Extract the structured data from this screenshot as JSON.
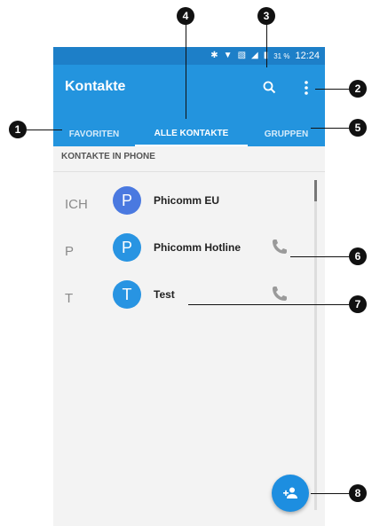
{
  "status_bar": {
    "battery_percent": "31 %",
    "time": "12:24"
  },
  "app_bar": {
    "title": "Kontakte",
    "actions": [
      "search-icon",
      "more-vert-icon"
    ]
  },
  "tabs": [
    {
      "label": "FAVORITEN",
      "active": false
    },
    {
      "label": "ALLE KONTAKTE",
      "active": true
    },
    {
      "label": "GRUPPEN",
      "active": false
    }
  ],
  "section_header": "KONTAKTE IN PHONE",
  "contacts": [
    {
      "index_letter": "ICH",
      "initial": "P",
      "name": "Phicomm EU",
      "avatar_color": "#4a79e0",
      "has_call": false
    },
    {
      "index_letter": "P",
      "initial": "P",
      "name": "Phicomm Hotline",
      "avatar_color": "#2894e2",
      "has_call": true
    },
    {
      "index_letter": "T",
      "initial": "T",
      "name": "Test",
      "avatar_color": "#2894e2",
      "has_call": true
    }
  ],
  "fab": {
    "icon": "add-contact-icon"
  },
  "callouts": [
    "1",
    "2",
    "3",
    "4",
    "5",
    "6",
    "7",
    "8"
  ],
  "colors": {
    "status_bar": "#1d7fc8",
    "app_bar": "#2394de",
    "accent": "#1d8ee0",
    "background": "#f3f3f3"
  }
}
